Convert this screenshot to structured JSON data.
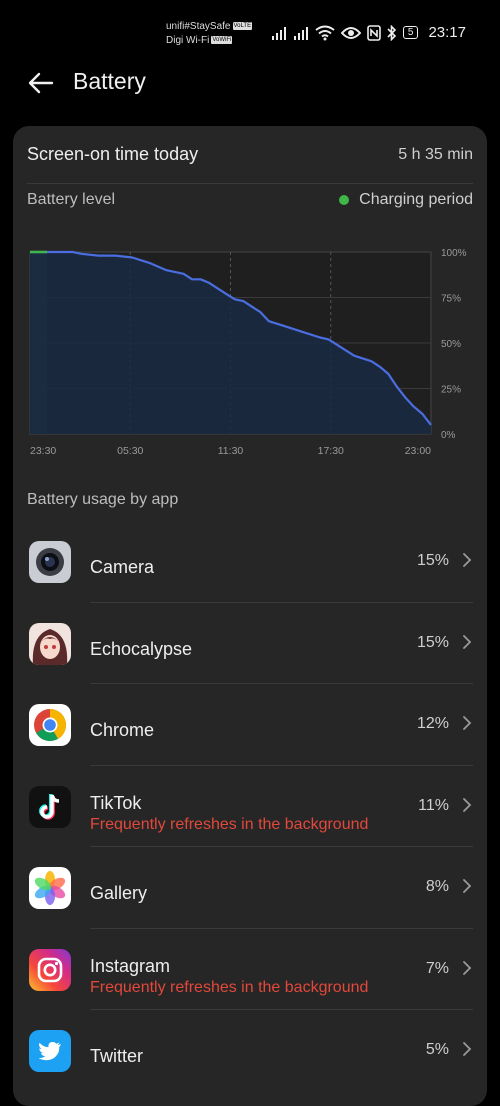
{
  "status_bar": {
    "carrier_line1": "unifi#StaySafe",
    "carrier_line1_tag": "VoLTE",
    "carrier_line2": "Digi Wi-Fi",
    "carrier_line2_tag": "VoWiFi",
    "battery_level": "5",
    "time": "23:17"
  },
  "header": {
    "title": "Battery"
  },
  "summary": {
    "screen_on_label": "Screen-on time today",
    "screen_on_value": "5 h 35 min",
    "battery_level_label": "Battery level",
    "charging_legend": "Charging period"
  },
  "chart_data": {
    "type": "area",
    "x_ticks": [
      "23:30",
      "05:30",
      "11:30",
      "17:30",
      "23:00"
    ],
    "y_ticks": [
      "100%",
      "75%",
      "50%",
      "25%",
      "0%"
    ],
    "ylim": [
      0,
      100
    ],
    "series": [
      {
        "x": [
          0,
          0.25,
          0.5,
          1.0,
          1.5,
          2.0,
          2.5,
          3.0,
          4.0,
          5.0,
          6.0,
          7.0,
          8.0,
          9.0,
          9.5,
          10.0,
          10.5,
          11.0,
          11.5,
          12.0,
          12.5,
          13.0,
          13.5,
          14.0,
          15.0,
          16.0,
          17.0,
          17.5,
          18.0,
          18.5,
          19.0,
          20.0,
          20.5,
          21.0,
          21.5,
          22.0,
          22.5,
          23.0,
          23.5
        ],
        "y": [
          100,
          100,
          100,
          100,
          100,
          100,
          100,
          99,
          98,
          98,
          97,
          94,
          90,
          88,
          85,
          85,
          83,
          80,
          77,
          74,
          73,
          70,
          67,
          62,
          59,
          56,
          53,
          52,
          49,
          46,
          43,
          40,
          37,
          33,
          26,
          20,
          15,
          11,
          5
        ]
      }
    ],
    "charging_period": [
      0,
      1
    ],
    "colors": {
      "line": "#4a6ee0",
      "fill": "#1a2a44",
      "charging": "#1e3a26"
    }
  },
  "usage": {
    "section_title": "Battery usage by app",
    "apps": [
      {
        "name": "Camera",
        "percent": "15%",
        "warning": "",
        "icon": "camera-icon"
      },
      {
        "name": "Echocalypse",
        "percent": "15%",
        "warning": "",
        "icon": "echocalypse-icon"
      },
      {
        "name": "Chrome",
        "percent": "12%",
        "warning": "",
        "icon": "chrome-icon"
      },
      {
        "name": "TikTok",
        "percent": "11%",
        "warning": "Frequently refreshes in the background",
        "icon": "tiktok-icon"
      },
      {
        "name": "Gallery",
        "percent": "8%",
        "warning": "",
        "icon": "gallery-icon"
      },
      {
        "name": "Instagram",
        "percent": "7%",
        "warning": "Frequently refreshes in the background",
        "icon": "instagram-icon"
      },
      {
        "name": "Twitter",
        "percent": "5%",
        "warning": "",
        "icon": "twitter-icon"
      }
    ]
  }
}
